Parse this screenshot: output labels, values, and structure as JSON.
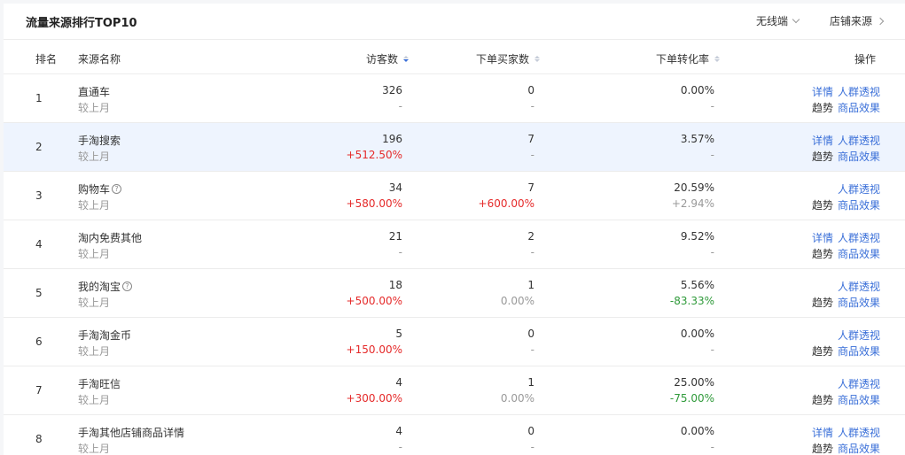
{
  "panel": {
    "title": "流量来源排行TOP10",
    "device_filter": "无线端",
    "store_source": "店铺来源"
  },
  "columns": {
    "rank": "排名",
    "source": "来源名称",
    "visitors": "访客数",
    "buyers": "下单买家数",
    "conversion": "下单转化率",
    "actions": "操作"
  },
  "sort": {
    "active_column": "visitors",
    "direction": "desc"
  },
  "icons": {
    "help": "question-circle-icon",
    "sort": "sort-caret-icon",
    "chevron_down": "chevron-down-icon",
    "chevron_right": "chevron-right-icon"
  },
  "colors": {
    "positive": "#e52a2a",
    "negative": "#2f9a3a",
    "link": "#3a6fd8",
    "highlight_row": "#eef4fe"
  },
  "rows": [
    {
      "rank": "1",
      "source": "直通车",
      "help": "",
      "compare": "较上月",
      "visitors": "326",
      "visitors_change": "-",
      "visitors_cls": "muted",
      "buyers": "0",
      "buyers_change": "-",
      "buyers_cls": "muted",
      "rate": "0.00%",
      "rate_change": "-",
      "rate_cls": "muted",
      "op_detail": "详情",
      "op_crowd": "人群透视",
      "op_trend": "趋势",
      "op_goods": "商品效果"
    },
    {
      "rank": "2",
      "source": "手淘搜索",
      "help": "",
      "compare": "较上月",
      "visitors": "196",
      "visitors_change": "+512.50%",
      "visitors_cls": "pos",
      "buyers": "7",
      "buyers_change": "-",
      "buyers_cls": "muted",
      "rate": "3.57%",
      "rate_change": "-",
      "rate_cls": "muted",
      "op_detail": "详情",
      "op_crowd": "人群透视",
      "op_trend": "趋势",
      "op_goods": "商品效果"
    },
    {
      "rank": "3",
      "source": "购物车",
      "help": "?",
      "compare": "较上月",
      "visitors": "34",
      "visitors_change": "+580.00%",
      "visitors_cls": "pos",
      "buyers": "7",
      "buyers_change": "+600.00%",
      "buyers_cls": "pos",
      "rate": "20.59%",
      "rate_change": "+2.94%",
      "rate_cls": "muted",
      "op_detail": "",
      "op_crowd": "人群透视",
      "op_trend": "趋势",
      "op_goods": "商品效果"
    },
    {
      "rank": "4",
      "source": "淘内免费其他",
      "help": "",
      "compare": "较上月",
      "visitors": "21",
      "visitors_change": "-",
      "visitors_cls": "muted",
      "buyers": "2",
      "buyers_change": "-",
      "buyers_cls": "muted",
      "rate": "9.52%",
      "rate_change": "-",
      "rate_cls": "muted",
      "op_detail": "详情",
      "op_crowd": "人群透视",
      "op_trend": "趋势",
      "op_goods": "商品效果"
    },
    {
      "rank": "5",
      "source": "我的淘宝",
      "help": "?",
      "compare": "较上月",
      "visitors": "18",
      "visitors_change": "+500.00%",
      "visitors_cls": "pos",
      "buyers": "1",
      "buyers_change": "0.00%",
      "buyers_cls": "muted",
      "rate": "5.56%",
      "rate_change": "-83.33%",
      "rate_cls": "neg",
      "op_detail": "",
      "op_crowd": "人群透视",
      "op_trend": "趋势",
      "op_goods": "商品效果"
    },
    {
      "rank": "6",
      "source": "手淘淘金币",
      "help": "",
      "compare": "较上月",
      "visitors": "5",
      "visitors_change": "+150.00%",
      "visitors_cls": "pos",
      "buyers": "0",
      "buyers_change": "-",
      "buyers_cls": "muted",
      "rate": "0.00%",
      "rate_change": "-",
      "rate_cls": "muted",
      "op_detail": "",
      "op_crowd": "人群透视",
      "op_trend": "趋势",
      "op_goods": "商品效果"
    },
    {
      "rank": "7",
      "source": "手淘旺信",
      "help": "",
      "compare": "较上月",
      "visitors": "4",
      "visitors_change": "+300.00%",
      "visitors_cls": "pos",
      "buyers": "1",
      "buyers_change": "0.00%",
      "buyers_cls": "muted",
      "rate": "25.00%",
      "rate_change": "-75.00%",
      "rate_cls": "neg",
      "op_detail": "",
      "op_crowd": "人群透视",
      "op_trend": "趋势",
      "op_goods": "商品效果"
    },
    {
      "rank": "8",
      "source": "手淘其他店铺商品详情",
      "help": "",
      "compare": "较上月",
      "visitors": "4",
      "visitors_change": "-",
      "visitors_cls": "muted",
      "buyers": "0",
      "buyers_change": "-",
      "buyers_cls": "muted",
      "rate": "0.00%",
      "rate_change": "-",
      "rate_cls": "muted",
      "op_detail": "详情",
      "op_crowd": "人群透视",
      "op_trend": "趋势",
      "op_goods": "商品效果"
    }
  ]
}
